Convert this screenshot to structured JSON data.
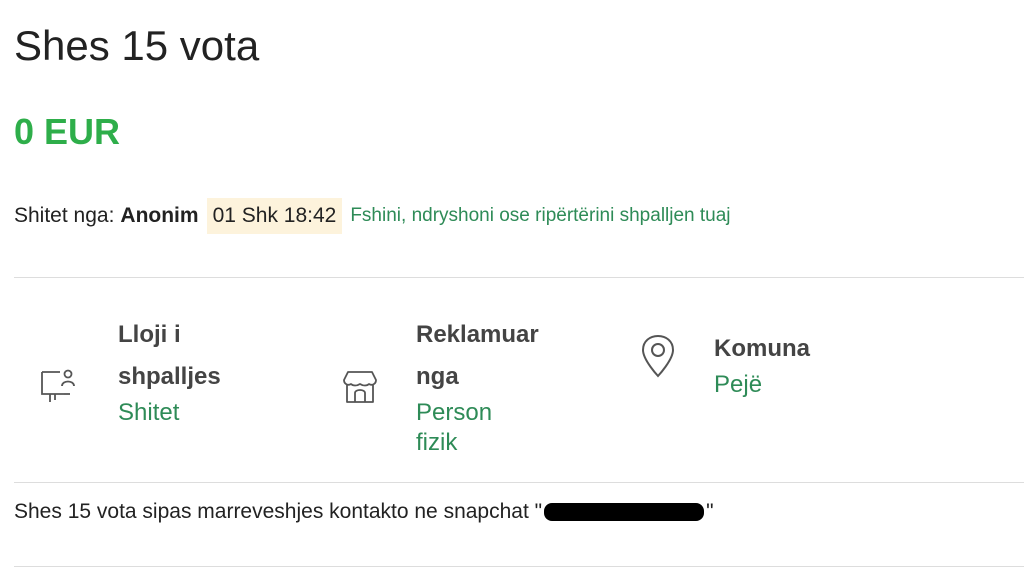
{
  "listing": {
    "title": "Shes 15 vota",
    "price": "0 EUR",
    "colors": {
      "price": "#2eae4a",
      "link": "#2e8b57",
      "date_bg": "#fdf3dc"
    }
  },
  "meta": {
    "seller_label": "Shitet nga:",
    "seller_name": "Anonim",
    "date": "01 Shk 18:42",
    "edit_link": "Fshini, ndryshoni ose ripërtërini shpalljen tuaj"
  },
  "details": [
    {
      "icon": "listing-type-icon",
      "label_line1": "Lloji i",
      "label_line2": "shpalljes",
      "value": "Shitet"
    },
    {
      "icon": "store-icon",
      "label_line1": "Reklamuar",
      "label_line2": "nga",
      "value": "Person fizik"
    },
    {
      "icon": "location-pin-icon",
      "label_line1": "Komuna",
      "label_line2": "",
      "value": "Pejë"
    }
  ],
  "description": {
    "text_before": "Shes 15 vota sipas marreveshjes kontakto ne snapchat \"",
    "text_after": "\""
  }
}
